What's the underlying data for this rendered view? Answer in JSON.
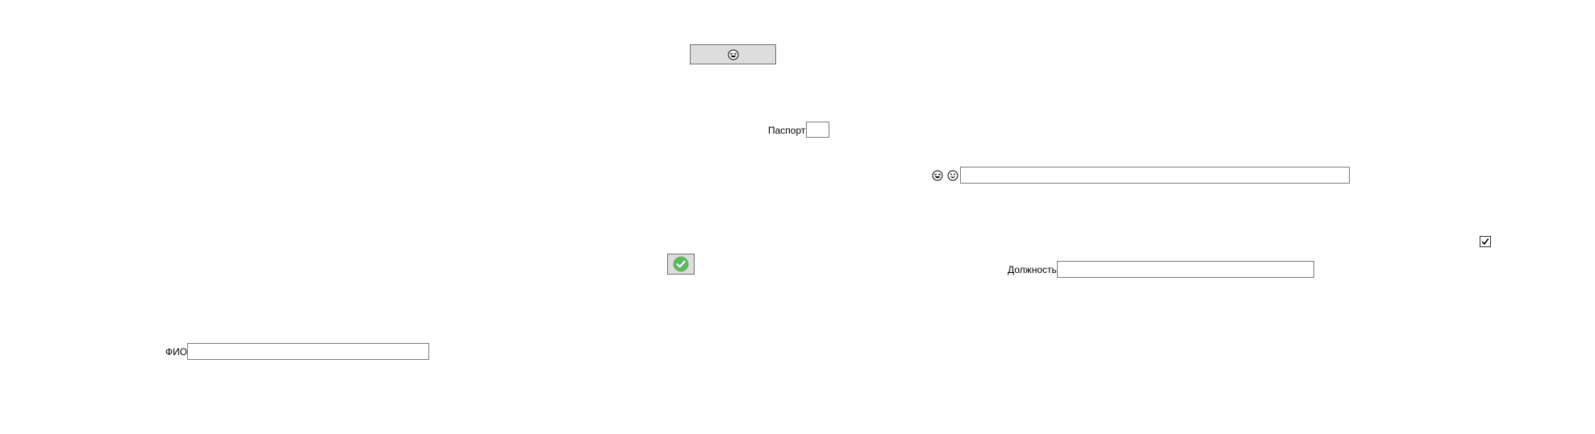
{
  "top_button": {
    "icon": "grinning-squint-icon"
  },
  "passport": {
    "label": "Паспорт",
    "value": ""
  },
  "emoji_field": {
    "icons": [
      "grinning-squint-icon",
      "grinning-icon"
    ],
    "value": ""
  },
  "checkbox": {
    "checked": true
  },
  "confirm_button": {
    "icon": "green-check-icon",
    "accent": "#5cb85c"
  },
  "position": {
    "label": "Должность",
    "value": ""
  },
  "full_name": {
    "label": "ФИО",
    "value": ""
  }
}
